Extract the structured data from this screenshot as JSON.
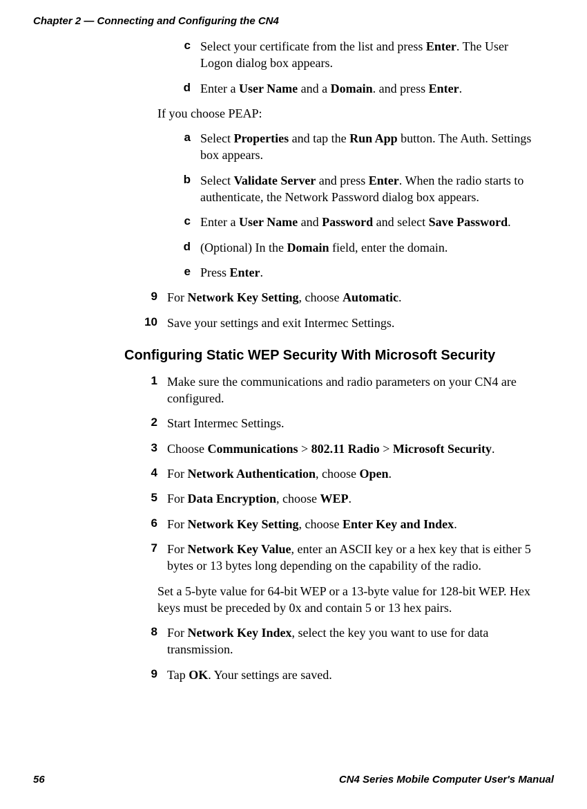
{
  "header": "Chapter 2 — Connecting and Configuring the CN4",
  "page_number": "56",
  "footer": "CN4 Series Mobile Computer User's Manual",
  "blocks": [
    {
      "type": "sub",
      "marker": "c",
      "html": "Select your certificate from the list and press <b>Enter</b>. The User Logon dialog box appears."
    },
    {
      "type": "sub",
      "marker": "d",
      "html": "Enter a <b>User Name</b> and a <b>Domain</b>. and press <b>Enter</b>."
    },
    {
      "type": "plain-sub",
      "html": "If you choose PEAP:"
    },
    {
      "type": "sub",
      "marker": "a",
      "html": "Select <b>Properties</b> and tap the <b>Run App</b> button. The Auth. Settings box appears."
    },
    {
      "type": "sub",
      "marker": "b",
      "html": "Select <b>Validate Server</b> and press <b>Enter</b>. When the radio starts to authenticate, the Network Password dialog box appears."
    },
    {
      "type": "sub",
      "marker": "c",
      "html": "Enter a <b>User Name</b> and <b>Password</b> and select <b>Save Password</b>."
    },
    {
      "type": "sub",
      "marker": "d",
      "html": "(Optional) In the <b>Domain</b> field, enter the domain."
    },
    {
      "type": "sub",
      "marker": "e",
      "html": "Press <b>Enter</b>."
    },
    {
      "type": "num",
      "marker": "9",
      "html": "For <b>Network Key Setting</b>, choose <b>Automatic</b>."
    },
    {
      "type": "num",
      "marker": "10",
      "html": "Save your settings and exit Intermec Settings."
    },
    {
      "type": "heading",
      "html": "Configuring Static WEP Security With Microsoft Security"
    },
    {
      "type": "num",
      "marker": "1",
      "html": "Make sure the communications and radio parameters on your CN4 are configured."
    },
    {
      "type": "num",
      "marker": "2",
      "html": "Start Intermec Settings."
    },
    {
      "type": "num",
      "marker": "3",
      "html": "Choose <b>Communications</b> > <b>802.11 Radio</b> > <b>Microsoft Security</b>."
    },
    {
      "type": "num",
      "marker": "4",
      "html": "For <b>Network Authentication</b>, choose <b>Open</b>."
    },
    {
      "type": "num",
      "marker": "5",
      "html": "For <b>Data Encryption</b>, choose <b>WEP</b>."
    },
    {
      "type": "num",
      "marker": "6",
      "html": "For <b>Network Key Setting</b>, choose <b>Enter Key and Index</b>."
    },
    {
      "type": "num",
      "marker": "7",
      "html": "For <b>Network Key Value</b>, enter an ASCII key or a hex key that is either 5 bytes or 13 bytes long depending on the capability of the radio."
    },
    {
      "type": "cont",
      "html": "Set a 5-byte value for 64-bit WEP or a 13-byte value for 128-bit WEP. Hex keys must be preceded by 0x and contain 5 or 13 hex pairs."
    },
    {
      "type": "num",
      "marker": "8",
      "html": "For <b>Network Key Index</b>, select the key you want to use for data transmission."
    },
    {
      "type": "num",
      "marker": "9",
      "html": "Tap <b>OK</b>. Your settings are saved."
    }
  ]
}
